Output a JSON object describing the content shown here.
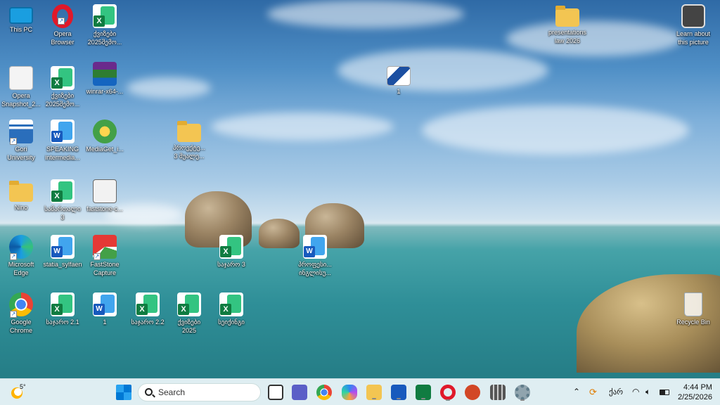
{
  "desktop": {
    "icons": [
      {
        "id": "this-pc",
        "label": "This PC",
        "icon": "monitor-icon"
      },
      {
        "id": "opera-browser",
        "label": "Opera\nBrowser",
        "icon": "opera-icon"
      },
      {
        "id": "excel-1",
        "label": "ქვიზები\n2025შემო...",
        "icon": "excel-icon"
      },
      {
        "id": "opera-snapshot",
        "label": "Opera\nSnapshot_2...",
        "icon": "document-icon"
      },
      {
        "id": "excel-2",
        "label": "ქვიზები\n2025შემო...",
        "icon": "excel-icon"
      },
      {
        "id": "winrar",
        "label": "winrar-x64-...",
        "icon": "winrar-icon"
      },
      {
        "id": "gori-university",
        "label": "Gori\nUniversity",
        "icon": "university-icon"
      },
      {
        "id": "speaking",
        "label": "SPEAKING\nintermedia...",
        "icon": "word-icon"
      },
      {
        "id": "mediaget",
        "label": "MediaGet_i...",
        "icon": "mediaget-icon"
      },
      {
        "id": "folder-1",
        "label": "პროექტე...\n3 შუალე...",
        "icon": "folder-icon"
      },
      {
        "id": "nino",
        "label": "Nino",
        "icon": "user-folder-icon"
      },
      {
        "id": "excel-3",
        "label": "სამართალი\n3",
        "icon": "excel-icon"
      },
      {
        "id": "faststone-c",
        "label": "faststone-c...",
        "icon": "faststone-installer-icon"
      },
      {
        "id": "edge",
        "label": "Microsoft\nEdge",
        "icon": "edge-icon"
      },
      {
        "id": "statia",
        "label": "statia_sylfaen",
        "icon": "word-icon"
      },
      {
        "id": "faststone-capture",
        "label": "FastStone\nCapture",
        "icon": "faststone-icon"
      },
      {
        "id": "excel-4",
        "label": "საჯარო 3",
        "icon": "excel-icon"
      },
      {
        "id": "word-2",
        "label": "პროფესი...\nინგლისუ...",
        "icon": "word-icon"
      },
      {
        "id": "chrome",
        "label": "Google\nChrome",
        "icon": "chrome-icon"
      },
      {
        "id": "excel-5",
        "label": "საჯარო 2.1",
        "icon": "excel-icon"
      },
      {
        "id": "word-3",
        "label": "1",
        "icon": "word-icon"
      },
      {
        "id": "excel-6",
        "label": "საჯარო 2.2",
        "icon": "excel-icon"
      },
      {
        "id": "excel-7",
        "label": "ქვიზები\n2025",
        "icon": "excel-icon"
      },
      {
        "id": "excel-8",
        "label": "სეიქინგი",
        "icon": "excel-icon"
      },
      {
        "id": "image-1",
        "label": "1",
        "icon": "image-file-icon"
      },
      {
        "id": "presentations",
        "label": "presentations\nlaw 2026",
        "icon": "folder-icon"
      },
      {
        "id": "learn-about",
        "label": "Learn about\nthis picture",
        "icon": "camera-icon"
      },
      {
        "id": "recycle-bin",
        "label": "Recycle Bin",
        "icon": "recycle-bin-icon"
      }
    ]
  },
  "taskbar": {
    "weather": "5°",
    "search_placeholder": "Search",
    "apps": [
      "windows-start-icon",
      "task-view-icon",
      "teams-icon",
      "chrome-icon",
      "copilot-icon",
      "file-explorer-icon",
      "word-icon",
      "excel-icon",
      "opera-icon",
      "powerpoint-icon",
      "calculator-icon",
      "settings-icon"
    ],
    "tray": {
      "language": "ქარ",
      "time": "4:44 PM",
      "date": "2/25/2026"
    }
  }
}
